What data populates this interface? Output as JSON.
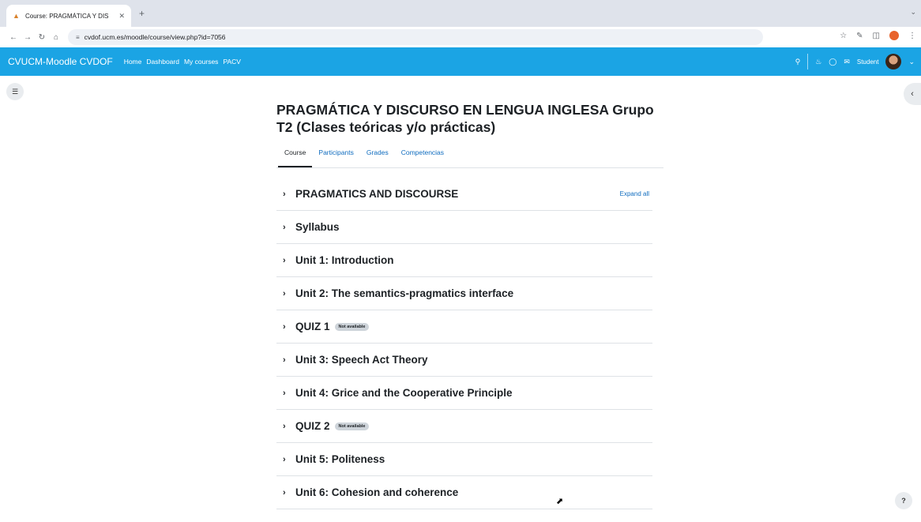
{
  "browser": {
    "tab_title": "Course: PRAGMÁTICA Y DIS",
    "new_tab": "+",
    "url": "cvdof.ucm.es/moodle/course/view.php?id=7056"
  },
  "navbar": {
    "brand": "CVUCM-Moodle CVDOF",
    "links": [
      "Home",
      "Dashboard",
      "My courses",
      "PACV"
    ],
    "user": "Student"
  },
  "course": {
    "title": "PRAGMÁTICA Y DISCURSO EN LENGUA INGLESA Grupo T2 (Clases teóricas y/o prácticas)",
    "tabs": [
      "Course",
      "Participants",
      "Grades",
      "Competencias"
    ],
    "expand_all": "Expand all",
    "sections": [
      {
        "title": "PRAGMATICS AND DISCOURSE",
        "badge": ""
      },
      {
        "title": "Syllabus",
        "badge": ""
      },
      {
        "title": "Unit 1: Introduction",
        "badge": ""
      },
      {
        "title": "Unit 2: The semantics-pragmatics interface",
        "badge": ""
      },
      {
        "title": "QUIZ 1",
        "badge": "Not available"
      },
      {
        "title": "Unit 3: Speech Act Theory",
        "badge": ""
      },
      {
        "title": "Unit 4: Grice and the Cooperative Principle",
        "badge": ""
      },
      {
        "title": "QUIZ 2",
        "badge": "Not available"
      },
      {
        "title": "Unit 5: Politeness",
        "badge": ""
      },
      {
        "title": "Unit 6: Cohesion and coherence",
        "badge": ""
      }
    ]
  },
  "help": "?"
}
